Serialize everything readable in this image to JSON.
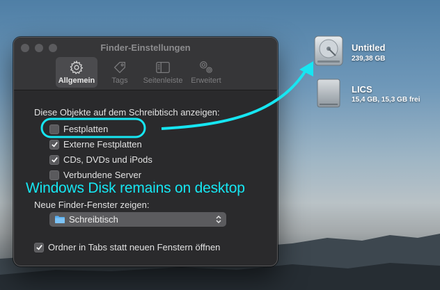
{
  "window": {
    "title": "Finder-Einstellungen",
    "tabs": [
      {
        "label": "Allgemein",
        "icon": "gear-icon",
        "active": true
      },
      {
        "label": "Tags",
        "icon": "tag-icon",
        "active": false
      },
      {
        "label": "Seitenleiste",
        "icon": "sidebar-icon",
        "active": false
      },
      {
        "label": "Erweitert",
        "icon": "gears-icon",
        "active": false
      }
    ]
  },
  "general": {
    "desktop_section_label": "Diese Objekte auf dem Schreibtisch anzeigen:",
    "options": [
      {
        "label": "Festplatten",
        "checked": false
      },
      {
        "label": "Externe Festplatten",
        "checked": true
      },
      {
        "label": "CDs, DVDs und iPods",
        "checked": true
      },
      {
        "label": "Verbundene Server",
        "checked": false
      }
    ],
    "new_window_label": "Neue Finder-Fenster zeigen:",
    "new_window_value": "Schreibtisch",
    "tabs_option": {
      "label": "Ordner in Tabs statt neuen Fenstern öffnen",
      "checked": true
    }
  },
  "desktop": {
    "items": [
      {
        "name": "Untitled",
        "detail": "239,38 GB",
        "icon": "internal-disk-icon"
      },
      {
        "name": "LICS",
        "detail": "15,4 GB, 15,3 GB frei",
        "icon": "external-disk-icon"
      }
    ]
  },
  "annotation": {
    "text": "Windows Disk remains on desktop",
    "color": "#16e6f2"
  }
}
